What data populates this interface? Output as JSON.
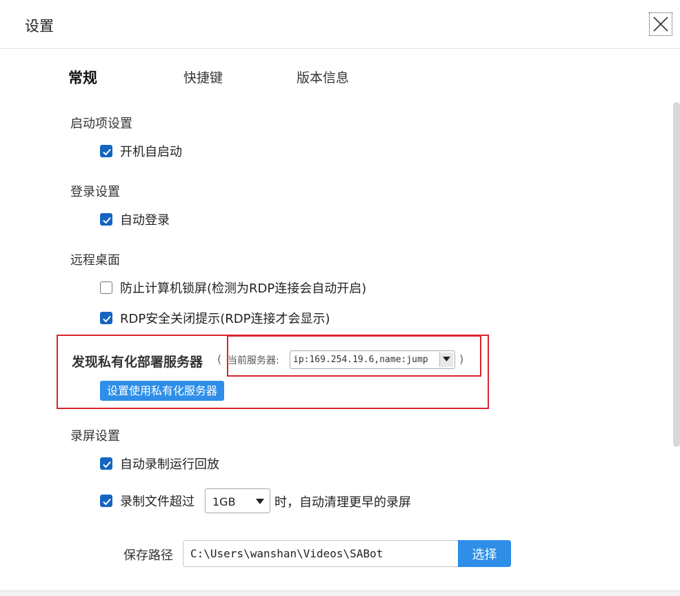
{
  "window": {
    "title": "设置"
  },
  "tabs": [
    {
      "label": "常规",
      "active": true
    },
    {
      "label": "快捷键",
      "active": false
    },
    {
      "label": "版本信息",
      "active": false
    }
  ],
  "startup": {
    "title": "启动项设置",
    "auto_start": {
      "label": "开机自启动",
      "checked": true
    }
  },
  "login": {
    "title": "登录设置",
    "auto_login": {
      "label": "自动登录",
      "checked": true
    }
  },
  "remote": {
    "title": "远程桌面",
    "prevent_lock": {
      "label": "防止计算机锁屏(检测为RDP连接会自动开启)",
      "checked": false
    },
    "rdp_close_tip": {
      "label": "RDP安全关闭提示(RDP连接才会显示)",
      "checked": true
    }
  },
  "private_server": {
    "title": "发现私有化部署服务器",
    "paren_open": "(",
    "paren_close": ")",
    "current_label": "当前服务器:",
    "current_value": "ip:169.254.19.6,name:jump",
    "button_label": "设置使用私有化服务器"
  },
  "recording": {
    "title": "录屏设置",
    "auto_record": {
      "label": "自动录制运行回放",
      "checked": true
    },
    "limit": {
      "label_before": "录制文件超过",
      "size_value": "1GB",
      "label_after": "时，自动清理更早的录屏",
      "checked": true
    },
    "save_path_label": "保存路径",
    "save_path_value": "C:\\Users\\wanshan\\Videos\\SABot",
    "choose_label": "选择"
  },
  "colors": {
    "accent": "#2e8ee8",
    "checkbox": "#1565c0",
    "highlight": "#d9232d"
  }
}
